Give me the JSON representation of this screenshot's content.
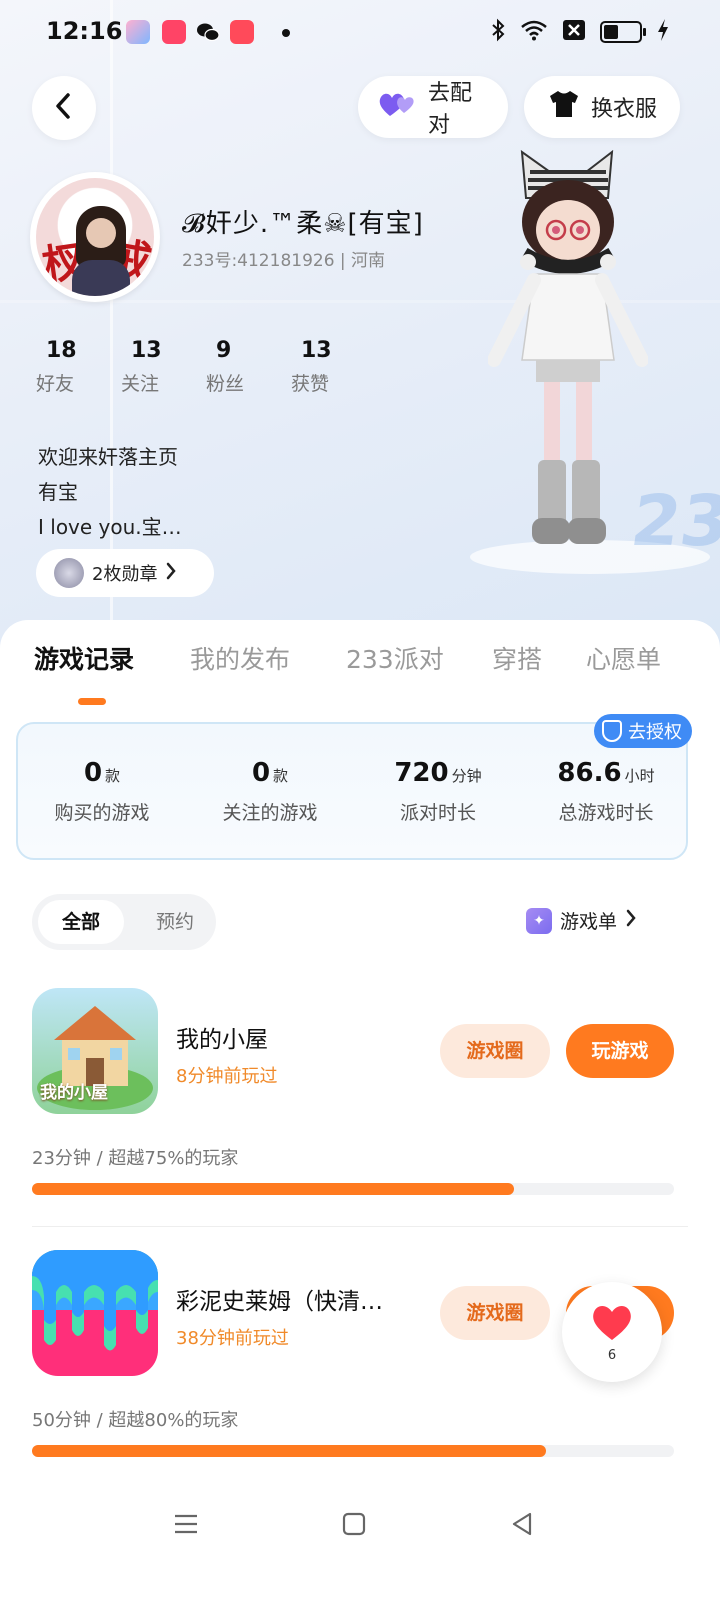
{
  "status_bar": {
    "time": "12:16",
    "app_icons": [
      "game-app-icon",
      "livestream-app-icon",
      "wechat-icon",
      "screen-recorder-icon"
    ],
    "right_icons": [
      "bluetooth-icon",
      "wifi-icon",
      "sim-off-icon",
      "battery-icon",
      "charging-icon"
    ]
  },
  "header": {
    "match_label": "去配对",
    "dress_label": "换衣服"
  },
  "profile": {
    "username": "𝓑奸少.™柔☠[有宝]",
    "uid_line": "233号:412181926 | 河南",
    "stats": [
      {
        "num": "18",
        "label": "好友"
      },
      {
        "num": "13",
        "label": "关注"
      },
      {
        "num": "9",
        "label": "粉丝"
      },
      {
        "num": "13",
        "label": "获赞"
      }
    ],
    "bio_lines": [
      "欢迎来奸落主页",
      "有宝",
      "I love you.宝…"
    ],
    "medal_label": "2枚勋章"
  },
  "tabs": [
    "游戏记录",
    "我的发布",
    "233派对",
    "穿搭",
    "心愿单"
  ],
  "summary": {
    "auth_label": "去授权",
    "items": [
      {
        "value": "0",
        "unit": "款",
        "label": "购买的游戏"
      },
      {
        "value": "0",
        "unit": "款",
        "label": "关注的游戏"
      },
      {
        "value": "720",
        "unit": "分钟",
        "label": "派对时长"
      },
      {
        "value": "86.6",
        "unit": "小时",
        "label": "总游戏时长"
      }
    ]
  },
  "filter": {
    "all": "全部",
    "reserve": "预约",
    "game_list": "游戏单"
  },
  "games": [
    {
      "name": "我的小屋",
      "ago": "8分钟前玩过",
      "circle_label": "游戏圈",
      "play_label": "玩游戏",
      "meta": "23分钟 / 超越75%的玩家",
      "progress": 0.75,
      "icon_text": "我的小屋"
    },
    {
      "name": "彩泥史莱姆（快清…",
      "ago": "38分钟前玩过",
      "circle_label": "游戏圈",
      "play_label": "玩游戏",
      "meta": "50分钟 / 超越80%的玩家",
      "progress": 0.8
    }
  ],
  "like": {
    "count": "6"
  },
  "colors": {
    "accent": "#ff7a1f",
    "auth_blue": "#3f8bf5",
    "like_red": "#ff3b4e"
  }
}
